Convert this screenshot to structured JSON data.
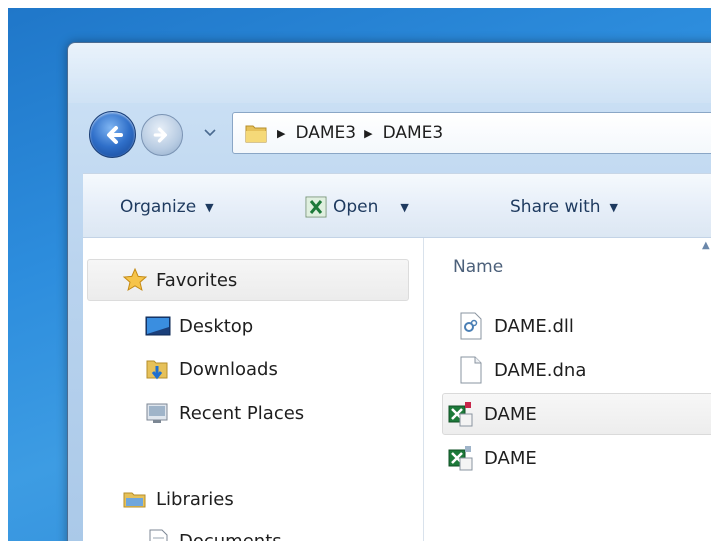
{
  "address": {
    "crumbs": [
      "DAME3",
      "DAME3"
    ],
    "separator": "▶"
  },
  "toolbar": {
    "organize_label": "Organize",
    "open_label": "Open",
    "share_label": "Share with",
    "caret": "▼"
  },
  "nav": {
    "favorites_label": "Favorites",
    "items": [
      {
        "label": "Desktop",
        "icon": "desktop-icon"
      },
      {
        "label": "Downloads",
        "icon": "downloads-folder-icon"
      },
      {
        "label": "Recent Places",
        "icon": "recent-places-icon"
      }
    ],
    "libraries_label": "Libraries",
    "library_items": [
      {
        "label": "Documents",
        "icon": "documents-icon"
      }
    ]
  },
  "file_list": {
    "column_name": "Name",
    "sort_arrow": "▲",
    "files": [
      {
        "name": "DAME.dll",
        "icon": "dll-file-icon"
      },
      {
        "name": "DAME.dna",
        "icon": "blank-file-icon"
      },
      {
        "name": "DAME",
        "icon": "excel-addin-icon"
      },
      {
        "name": "DAME",
        "icon": "excel-addin-icon"
      }
    ]
  },
  "colors": {
    "desktop_blue": "#2d8ddd",
    "window_frame": "#b9d3ee",
    "toolbar_text": "#1e3a5f",
    "excel_green": "#1d7a3a"
  }
}
